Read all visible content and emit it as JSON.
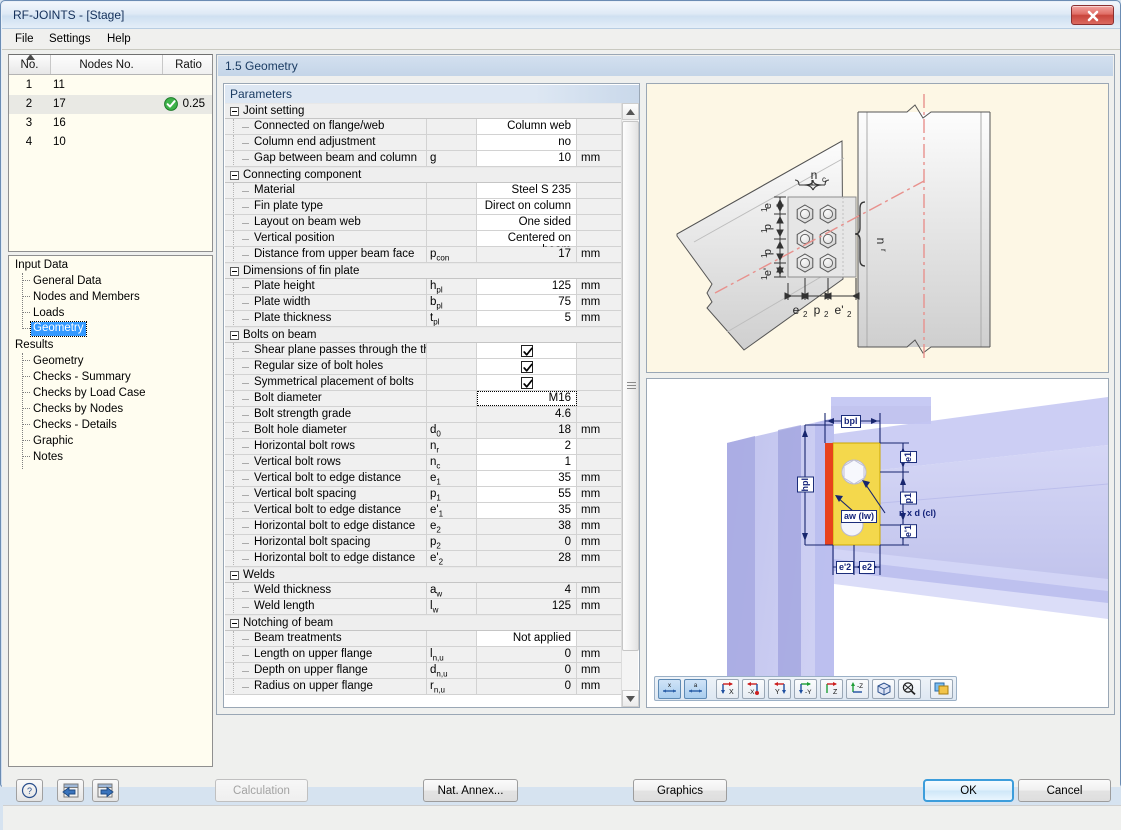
{
  "window": {
    "title": "RF-JOINTS - [Stage]",
    "close_label": "x"
  },
  "menu": [
    {
      "label": "File"
    },
    {
      "label": "Settings"
    },
    {
      "label": "Help"
    }
  ],
  "node_list": {
    "columns": [
      "No.",
      "Nodes No.",
      "Ratio"
    ],
    "rows": [
      {
        "no": "1",
        "node": "11",
        "ratio": "",
        "status": "",
        "selected": false
      },
      {
        "no": "2",
        "node": "17",
        "ratio": "0.25",
        "status": "ok",
        "selected": true
      },
      {
        "no": "3",
        "node": "16",
        "ratio": "",
        "status": "",
        "selected": false
      },
      {
        "no": "4",
        "node": "10",
        "ratio": "",
        "status": "",
        "selected": false
      }
    ]
  },
  "navtree": {
    "groups": [
      {
        "label": "Input Data",
        "items": [
          {
            "label": "General Data",
            "active": false
          },
          {
            "label": "Nodes and Members",
            "active": false
          },
          {
            "label": "Loads",
            "active": false
          },
          {
            "label": "Geometry",
            "active": true
          }
        ]
      },
      {
        "label": "Results",
        "items": [
          {
            "label": "Geometry",
            "active": false
          },
          {
            "label": "Checks - Summary",
            "active": false
          },
          {
            "label": "Checks by Load Case",
            "active": false
          },
          {
            "label": "Checks by Nodes",
            "active": false
          },
          {
            "label": "Checks - Details",
            "active": false
          },
          {
            "label": "Graphic",
            "active": false
          },
          {
            "label": "Notes",
            "active": false
          }
        ]
      }
    ]
  },
  "section": {
    "title": "1.5 Geometry",
    "params_caption": "Parameters"
  },
  "parameters": [
    {
      "type": "group",
      "label": "Joint setting"
    },
    {
      "type": "row",
      "name": "Connected on flange/web",
      "symbol": "",
      "symbol_sub": "",
      "value": "Column web",
      "unit": "",
      "editable": true
    },
    {
      "type": "row",
      "name": "Column end adjustment",
      "symbol": "",
      "symbol_sub": "",
      "value": "no",
      "unit": "",
      "editable": true
    },
    {
      "type": "row",
      "name": "Gap between beam and column",
      "symbol": "g",
      "symbol_sub": "",
      "value": "10",
      "unit": "mm",
      "editable": true
    },
    {
      "type": "group",
      "label": "Connecting component"
    },
    {
      "type": "row",
      "name": "Material",
      "symbol": "",
      "symbol_sub": "",
      "value": "Steel S 235",
      "unit": "",
      "editable": true
    },
    {
      "type": "row",
      "name": "Fin plate type",
      "symbol": "",
      "symbol_sub": "",
      "value": "Direct on column",
      "unit": "",
      "editable": true
    },
    {
      "type": "row",
      "name": "Layout on beam web",
      "symbol": "",
      "symbol_sub": "",
      "value": "One sided",
      "unit": "",
      "editable": true
    },
    {
      "type": "row",
      "name": "Vertical position",
      "symbol": "",
      "symbol_sub": "",
      "value": "Centered on beam",
      "unit": "",
      "editable": true
    },
    {
      "type": "row",
      "name": "Distance from upper beam face",
      "symbol": "p",
      "symbol_sub": "con",
      "value": "17",
      "unit": "mm",
      "editable": false
    },
    {
      "type": "group",
      "label": "Dimensions of fin plate"
    },
    {
      "type": "row",
      "name": "Plate height",
      "symbol": "h",
      "symbol_sub": "pl",
      "value": "125",
      "unit": "mm",
      "editable": true
    },
    {
      "type": "row",
      "name": "Plate width",
      "symbol": "b",
      "symbol_sub": "pl",
      "value": "75",
      "unit": "mm",
      "editable": true
    },
    {
      "type": "row",
      "name": "Plate thickness",
      "symbol": "t",
      "symbol_sub": "pl",
      "value": "5",
      "unit": "mm",
      "editable": true
    },
    {
      "type": "group",
      "label": "Bolts on beam"
    },
    {
      "type": "check",
      "name": "Shear plane passes through the thre",
      "symbol": "",
      "symbol_sub": "",
      "checked": true,
      "unit": ""
    },
    {
      "type": "check",
      "name": "Regular size of bolt holes",
      "symbol": "",
      "symbol_sub": "",
      "checked": true,
      "unit": ""
    },
    {
      "type": "check",
      "name": "Symmetrical placement of bolts",
      "symbol": "",
      "symbol_sub": "",
      "checked": true,
      "unit": ""
    },
    {
      "type": "row",
      "name": "Bolt diameter",
      "symbol": "",
      "symbol_sub": "",
      "value": "M16",
      "unit": "",
      "editable": true,
      "focused": true
    },
    {
      "type": "row",
      "name": "Bolt strength grade",
      "symbol": "",
      "symbol_sub": "",
      "value": "4.6",
      "unit": "",
      "editable": false
    },
    {
      "type": "row",
      "name": "Bolt hole diameter",
      "symbol": "d",
      "symbol_sub": "0",
      "value": "18",
      "unit": "mm",
      "editable": false
    },
    {
      "type": "row",
      "name": "Horizontal bolt rows",
      "symbol": "n",
      "symbol_sub": "r",
      "value": "2",
      "unit": "",
      "editable": true
    },
    {
      "type": "row",
      "name": "Vertical bolt rows",
      "symbol": "n",
      "symbol_sub": "c",
      "value": "1",
      "unit": "",
      "editable": true
    },
    {
      "type": "row",
      "name": "Vertical bolt to edge distance",
      "symbol": "e",
      "symbol_sub": "1",
      "value": "35",
      "unit": "mm",
      "editable": true
    },
    {
      "type": "row",
      "name": "Vertical bolt spacing",
      "symbol": "p",
      "symbol_sub": "1",
      "value": "55",
      "unit": "mm",
      "editable": true
    },
    {
      "type": "row",
      "name": "Vertical bolt to edge distance",
      "symbol": "e'",
      "symbol_sub": "1",
      "value": "35",
      "unit": "mm",
      "editable": true
    },
    {
      "type": "row",
      "name": "Horizontal bolt to edge distance",
      "symbol": "e",
      "symbol_sub": "2",
      "value": "38",
      "unit": "mm",
      "editable": false
    },
    {
      "type": "row",
      "name": "Horizontal bolt spacing",
      "symbol": "p",
      "symbol_sub": "2",
      "value": "0",
      "unit": "mm",
      "editable": false
    },
    {
      "type": "row",
      "name": "Horizontal bolt to edge distance",
      "symbol": "e'",
      "symbol_sub": "2",
      "value": "28",
      "unit": "mm",
      "editable": false
    },
    {
      "type": "group",
      "label": "Welds"
    },
    {
      "type": "row",
      "name": "Weld thickness",
      "symbol": "a",
      "symbol_sub": "w",
      "value": "4",
      "unit": "mm",
      "editable": false
    },
    {
      "type": "row",
      "name": "Weld length",
      "symbol": "l",
      "symbol_sub": "w",
      "value": "125",
      "unit": "mm",
      "editable": false
    },
    {
      "type": "group",
      "label": "Notching of beam"
    },
    {
      "type": "row",
      "name": "Beam treatments",
      "symbol": "",
      "symbol_sub": "",
      "value": "Not applied",
      "unit": "",
      "editable": true
    },
    {
      "type": "row",
      "name": "Length on upper flange",
      "symbol": "l",
      "symbol_sub": "n,u",
      "value": "0",
      "unit": "mm",
      "editable": false
    },
    {
      "type": "row",
      "name": "Depth on upper flange",
      "symbol": "d",
      "symbol_sub": "n,u",
      "value": "0",
      "unit": "mm",
      "editable": false
    },
    {
      "type": "row",
      "name": "Radius on upper flange",
      "symbol": "r",
      "symbol_sub": "n,u",
      "value": "0",
      "unit": "mm",
      "editable": false
    }
  ],
  "diagram_top": {
    "labels": [
      "n_c",
      "n_r",
      "e_1",
      "p_1",
      "p_1",
      "e'_1",
      "e_2",
      "p_2",
      "e'_2"
    ],
    "label_nc": "n",
    "label_nc_sub": "c",
    "label_nr": "n",
    "label_nr_sub": "r",
    "label_e1": "e",
    "label_e1_sub": "1",
    "label_p1": "p",
    "label_p1_sub": "1",
    "label_e1p": "e'",
    "label_e1p_sub": "1",
    "label_e2": "e",
    "label_e2_sub": "2",
    "label_p2": "p",
    "label_p2_sub": "2",
    "label_e2p": "e'",
    "label_e2p_sub": "2"
  },
  "diagram_3d": {
    "labels": {
      "bpl": "bpl",
      "hpl": "hpl",
      "e1": "e1",
      "p1": "p1",
      "e1p": "e'1",
      "e2": "e2",
      "e2p": "e'2",
      "aw": "aw (lw)",
      "nxd": "n x d (cl)"
    },
    "plate_color": "#f4d84c",
    "weld_color": "#e03a1e",
    "steel_color": "#b0b3e8"
  },
  "gfx_toolbar": [
    {
      "icon": "dim-x-icon",
      "label": "x",
      "active": true
    },
    {
      "icon": "dim-a-icon",
      "label": "a",
      "active": true
    },
    {
      "icon": "view-x-icon",
      "label": "X",
      "active": false
    },
    {
      "icon": "view-minus-x-icon",
      "label": "-X",
      "active": false
    },
    {
      "icon": "view-y-icon",
      "label": "Y",
      "active": false
    },
    {
      "icon": "view-minus-y-icon",
      "label": "-Y",
      "active": false
    },
    {
      "icon": "view-z-icon",
      "label": "Z",
      "active": false
    },
    {
      "icon": "view-minus-z-icon",
      "label": "-Z",
      "active": false
    },
    {
      "icon": "isometric-view-icon",
      "label": "",
      "active": false
    },
    {
      "icon": "zoom-all-icon",
      "label": "",
      "active": false
    },
    {
      "icon": "render-mode-icon",
      "label": "",
      "active": false
    }
  ],
  "footer": {
    "help_icon": "help-icon",
    "prev_icon": "previous-icon",
    "next_icon": "next-icon",
    "calculation": "Calculation",
    "nat_annex": "Nat. Annex...",
    "graphics": "Graphics",
    "ok": "OK",
    "cancel": "Cancel"
  },
  "colors": {
    "accent": "#3399ff",
    "title": "#1b3c63",
    "ok_green": "#2ea53a",
    "close_red": "#c8453c"
  }
}
